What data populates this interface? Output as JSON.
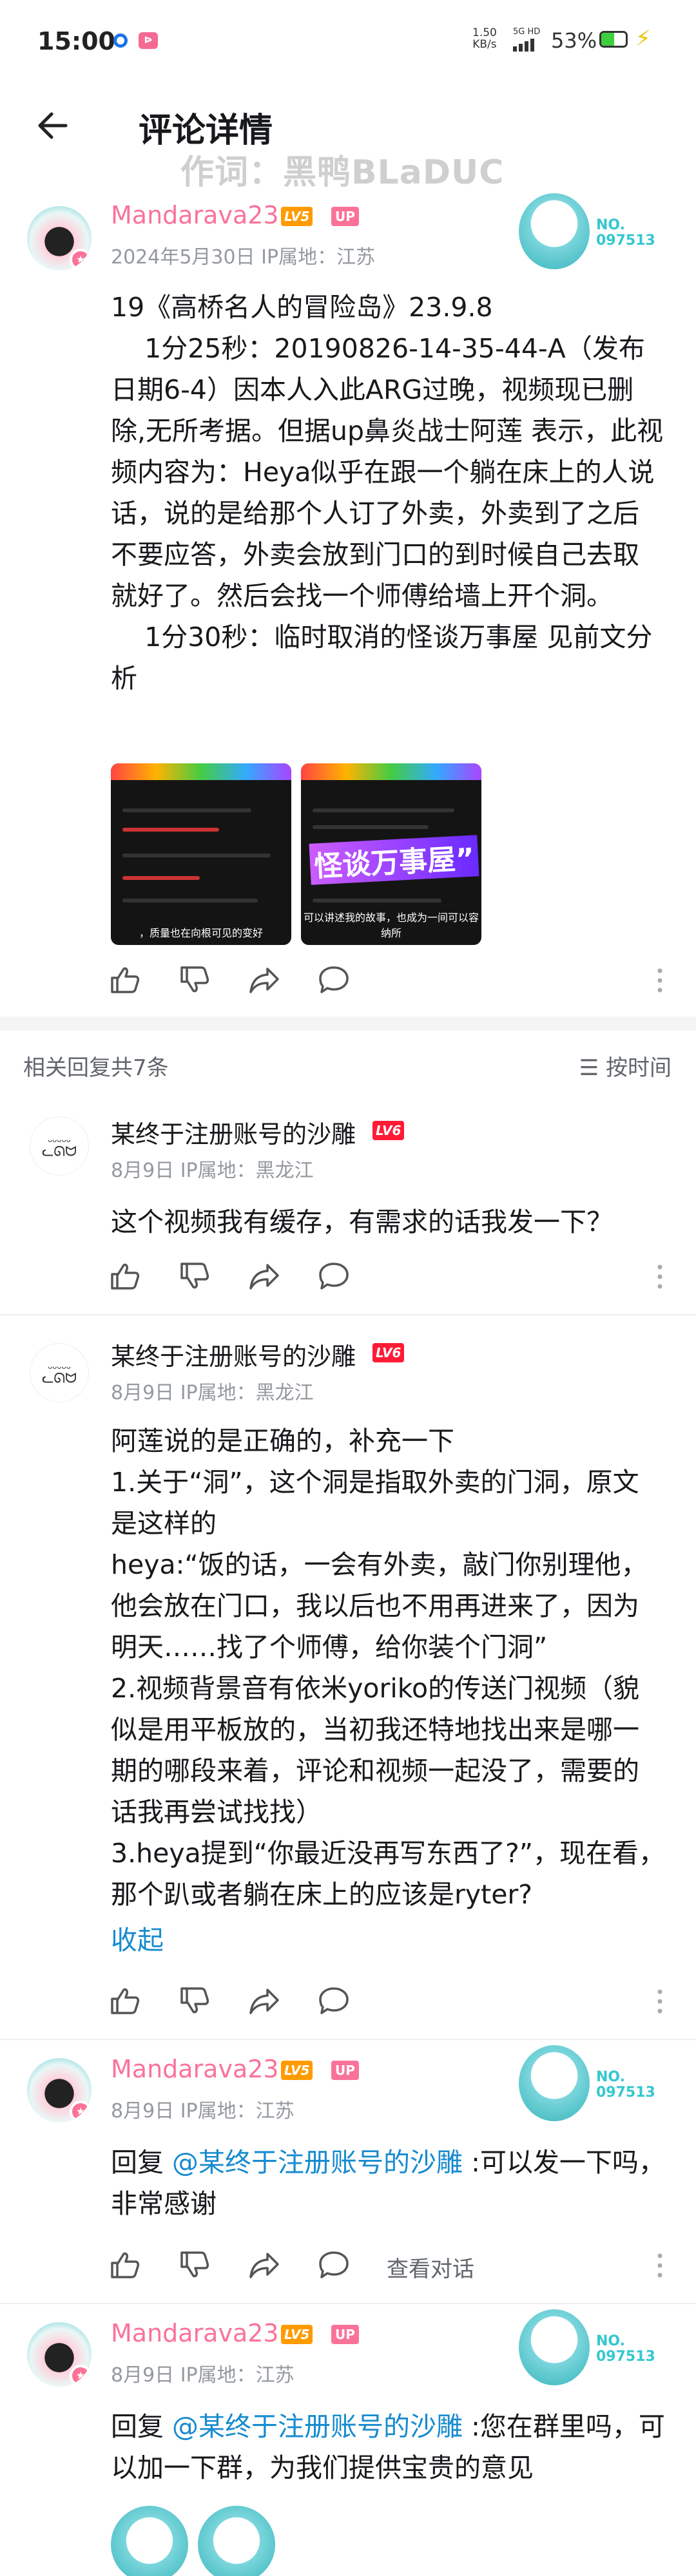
{
  "status_bar": {
    "time": "15:00",
    "network_speed": "1.50",
    "network_unit": "KB/s",
    "signal": "5G HD",
    "battery_pct": "53%",
    "battery_level": 0.53
  },
  "header": {
    "title": "评论详情",
    "watermark": "作词：黑鸭BLaDUC"
  },
  "main_comment": {
    "username": "Mandarava23",
    "level": "LV5",
    "up_badge": "UP",
    "date": "2024年5月30日 IP属地：江苏",
    "fan_number": "NO.\n097513",
    "text": "19《高桥名人的冒险岛》23.9.8\n    1分25秒：20190826-14-35-44-A（发布日期6-4）因本人入此ARG过晚，视频现已删除,无所考据。但据up鼻炎战士阿莲 表示，此视频内容为：Heya似乎在跟一个躺在床上的人说话，说的是给那个人订了外卖，外卖到了之后不要应答，外卖会放到门口的到时候自己去取就好了。然后会找一个师傅给墙上开个洞。\n    1分30秒：临时取消的怪谈万事屋 见前文分析",
    "images": [
      {
        "caption": "，质量也在向根可见的变好"
      },
      {
        "caption": "可以讲述我的故事，也成为一间可以容纳所",
        "big_text": "怪谈万事屋”"
      }
    ]
  },
  "replies_header": {
    "count_label": "相关回复共7条",
    "sort_label": "按时间"
  },
  "replies": [
    {
      "username": "某终于注册账号的沙雕",
      "level": "LV6",
      "date": "8月9日 IP属地：黑龙江",
      "text": "这个视频我有缓存，有需求的话我发一下？"
    },
    {
      "username": "某终于注册账号的沙雕",
      "level": "LV6",
      "date": "8月9日 IP属地：黑龙江",
      "text": "阿莲说的是正确的，补充一下\n1.关于“洞”，这个洞是指取外卖的门洞，原文是这样的\nheya:“饭的话，一会有外卖，敲门你别理他，他会放在门口，我以后也不用再进来了，因为明天……找了个师傅，给你装个门洞”\n2.视频背景音有依米yoriko的传送门视频（貌似是用平板放的，当初我还特地找出来是哪一期的哪段来着，评论和视频一起没了，需要的话我再尝试找找）\n3.heya提到“你最近没再写东西了?”，现在看，那个趴或者躺在床上的应该是ryter?",
      "collapse": "收起"
    },
    {
      "username": "Mandarava23",
      "level": "LV5",
      "up_badge": "UP",
      "date": "8月9日 IP属地：江苏",
      "fan_number": "NO.\n097513",
      "reply_prefix": "回复 ",
      "mention": "@某终于注册账号的沙雕",
      "text": " :可以发一下吗，非常感谢",
      "view_chat": "查看对话"
    },
    {
      "username": "Mandarava23",
      "level": "LV5",
      "up_badge": "UP",
      "date": "8月9日 IP属地：江苏",
      "fan_number": "NO.\n097513",
      "reply_prefix": "回复 ",
      "mention": "@某终于注册账号的沙雕",
      "text": " :您在群里吗，可以加一下群，为我们提供宝贵的意见"
    }
  ],
  "colors": {
    "accent_pink": "#fb7299",
    "link_blue": "#178bcf",
    "lv5": "#ff9b00",
    "lv6": "#ff1a35"
  }
}
